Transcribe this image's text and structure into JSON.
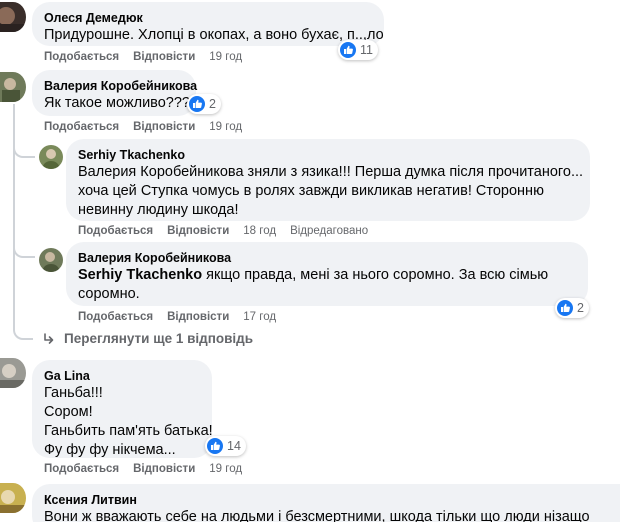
{
  "comments": [
    {
      "author": "Олеся Демедюк",
      "lines": [
        "Придурошне. Хлопці в окопах, а воно бухає, п..,ло"
      ],
      "reactions": "11",
      "like": "Подобається",
      "reply": "Відповісти",
      "time": "19 год"
    },
    {
      "author": "Валерия Коробейникова",
      "lines": [
        "Як такое можливо???"
      ],
      "reactions": "2",
      "like": "Подобається",
      "reply": "Відповісти",
      "time": "19 год"
    },
    {
      "author": "Serhiy Tkachenko",
      "lines": [
        "Валерия Коробейникова зняли з язика!!! Перша думка після прочитаного...",
        "хоча цей Ступка чомусь в ролях завжди викликав негатив! Сторонню",
        "невинну людину шкода!"
      ],
      "like": "Подобається",
      "reply": "Відповісти",
      "time": "18 год",
      "edited": "Відредаговано"
    },
    {
      "author": "Валерия Коробейникова",
      "mention": "Serhiy Tkachenko",
      "line1_rest": " якщо правда, мені за нього соромно. За всю сімью",
      "line2": "соромно.",
      "reactions": "2",
      "like": "Подобається",
      "reply": "Відповісти",
      "time": "17 год"
    },
    {
      "author": "Ga Lina",
      "lines": [
        "Ганьба!!!",
        "Сором!",
        "Ганьбить пам'ять батька!",
        "Фу фу фу нікчема..."
      ],
      "reactions": "14",
      "like": "Подобається",
      "reply": "Відповісти",
      "time": "19 год"
    },
    {
      "author": "Ксения Литвин",
      "lines": [
        "Вони ж вважають себе на людьми і безсмертними, шкода тільки що люди нізащо"
      ]
    }
  ],
  "more_replies": "Переглянути ще 1 відповідь",
  "colors": {
    "bubble": "#f0f2f5",
    "like_blue": "#1877f2",
    "meta_gray": "#65676b"
  }
}
